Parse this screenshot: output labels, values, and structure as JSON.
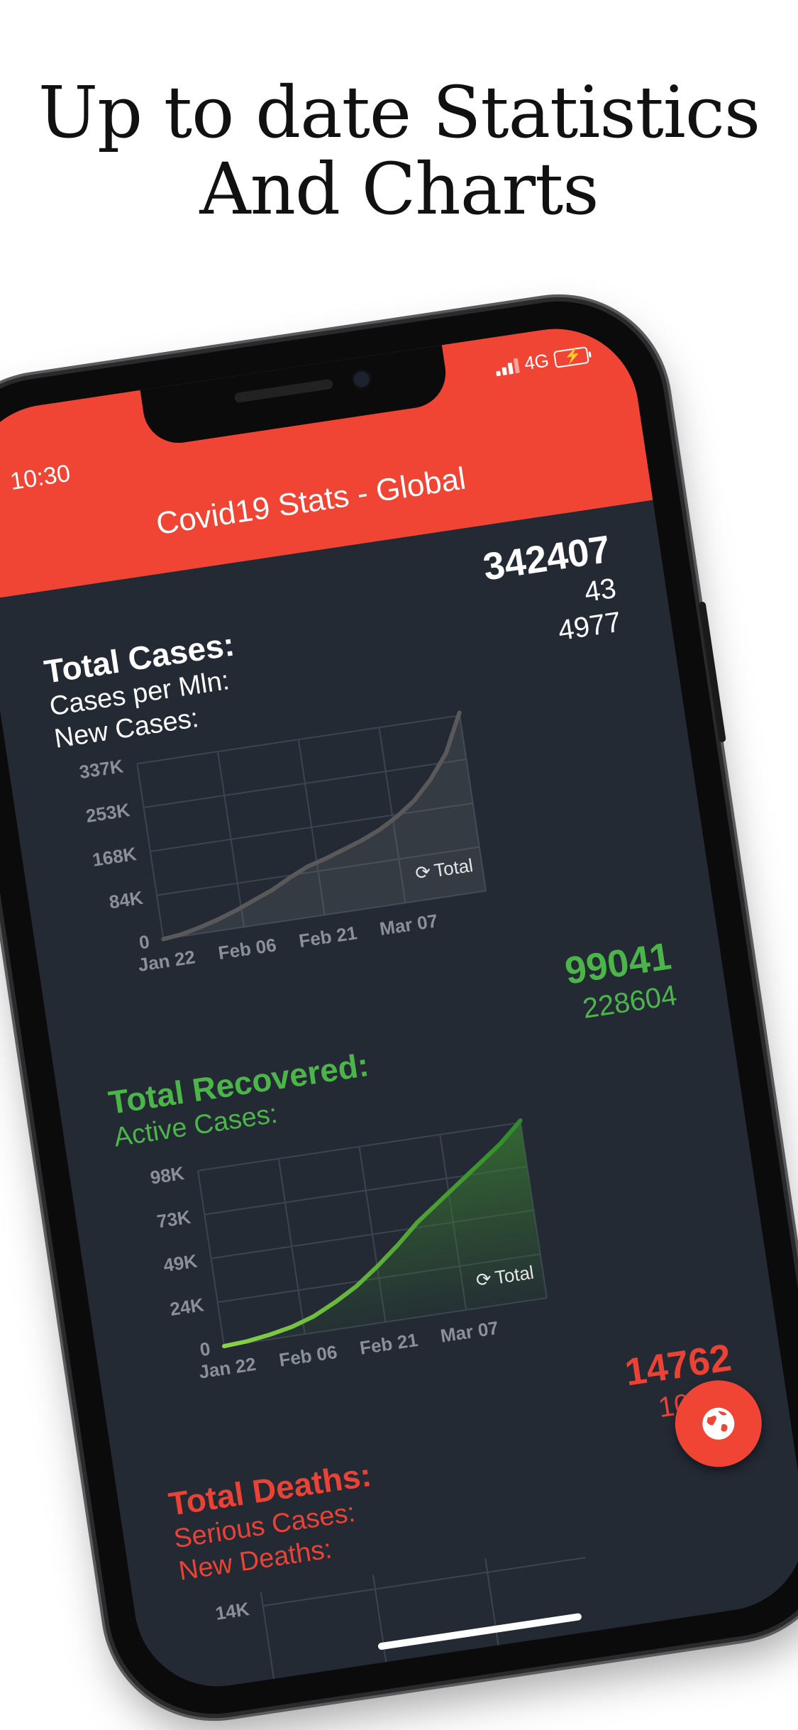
{
  "headline": {
    "line1": "Up to date Statistics",
    "line2": "And Charts"
  },
  "status_bar": {
    "time": "10:30",
    "network": "4G"
  },
  "app": {
    "title": "Covid19 Stats - Global"
  },
  "colors": {
    "appbar": "#f04535",
    "background": "#232a34",
    "cases": "#ffffff",
    "recovered": "#4cb54a",
    "deaths": "#ea4235"
  },
  "cases": {
    "title": "Total Cases:",
    "total": "342407",
    "rows": [
      {
        "label": "Cases per Mln:",
        "value": "43"
      },
      {
        "label": "New Cases:",
        "value": "4977"
      }
    ],
    "legend": "Total"
  },
  "recovered": {
    "title": "Total Recovered:",
    "total": "99041",
    "rows": [
      {
        "label": "Active Cases:",
        "value": "228604"
      }
    ],
    "legend": "Total"
  },
  "deaths": {
    "title": "Total Deaths:",
    "total": "14762",
    "rows": [
      {
        "label": "Serious Cases:",
        "value": "10566"
      },
      {
        "label": "New Deaths:",
        "value": ""
      }
    ],
    "first_tick": "14K"
  },
  "fab": {
    "icon": "globe-icon"
  },
  "chart_data": [
    {
      "type": "area",
      "series": [
        {
          "name": "Total",
          "values": [
            0,
            4000,
            12000,
            22000,
            34000,
            48000,
            62000,
            80000,
            96000,
            106000,
            118000,
            130000,
            145000,
            165000,
            190000,
            225000,
            270000,
            342407
          ]
        }
      ],
      "x_tick_labels": [
        "Jan 22",
        "Feb 06",
        "Feb 21",
        "Mar 07"
      ],
      "y_tick_labels": [
        "0",
        "84K",
        "168K",
        "253K",
        "337K"
      ],
      "ylim": [
        0,
        337000
      ],
      "grid": true,
      "legend": "bottom-right"
    },
    {
      "type": "area",
      "series": [
        {
          "name": "Total",
          "values": [
            0,
            800,
            2500,
            5000,
            9000,
            15000,
            22000,
            31000,
            41000,
            52000,
            61000,
            70000,
            79000,
            88000,
            99041
          ]
        }
      ],
      "x_tick_labels": [
        "Jan 22",
        "Feb 06",
        "Feb 21",
        "Mar 07"
      ],
      "y_tick_labels": [
        "0",
        "24K",
        "49K",
        "73K",
        "98K"
      ],
      "ylim": [
        0,
        98000
      ],
      "grid": true,
      "legend": "bottom-right"
    }
  ]
}
